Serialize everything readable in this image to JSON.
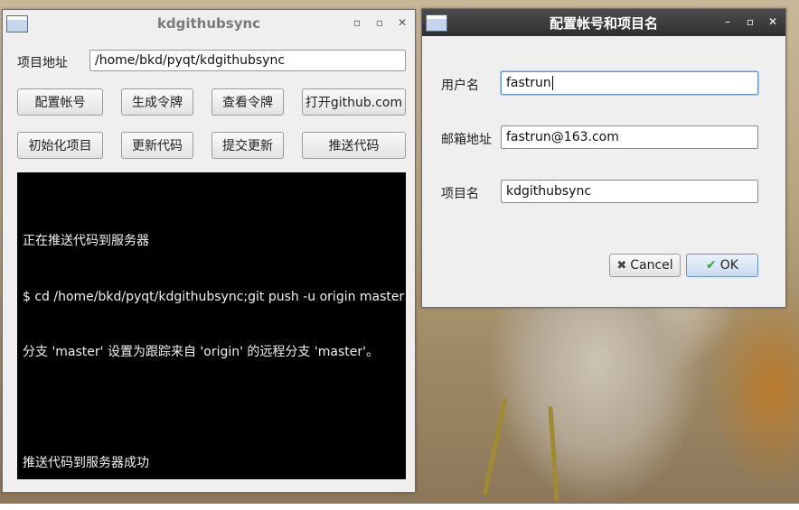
{
  "main_window": {
    "title": "kdgithubsync",
    "controls": {
      "minimize": "▫",
      "maximize": "▫",
      "close": "✕"
    },
    "project_path_label": "项目地址",
    "project_path_value": "/home/bkd/pyqt/kdgithubsync",
    "buttons_row1": [
      "配置帐号",
      "生成令牌",
      "查看令牌",
      "打开github.com"
    ],
    "buttons_row2": [
      "初始化项目",
      "更新代码",
      "提交更新",
      "推送代码"
    ],
    "console_lines": [
      "正在推送代码到服务器",
      "$ cd /home/bkd/pyqt/kdgithubsync;git push -u origin master",
      "分支 'master' 设置为跟踪来自 'origin' 的远程分支 'master'。",
      "",
      "推送代码到服务器成功"
    ]
  },
  "dialog": {
    "title": "配置帐号和项目名",
    "username_label": "用户名",
    "username_value": "fastrun",
    "email_label": "邮箱地址",
    "email_value": "fastrun@163.com",
    "project_label": "项目名",
    "project_value": "kdgithubsync",
    "cancel_label": "Cancel",
    "ok_label": "OK"
  }
}
